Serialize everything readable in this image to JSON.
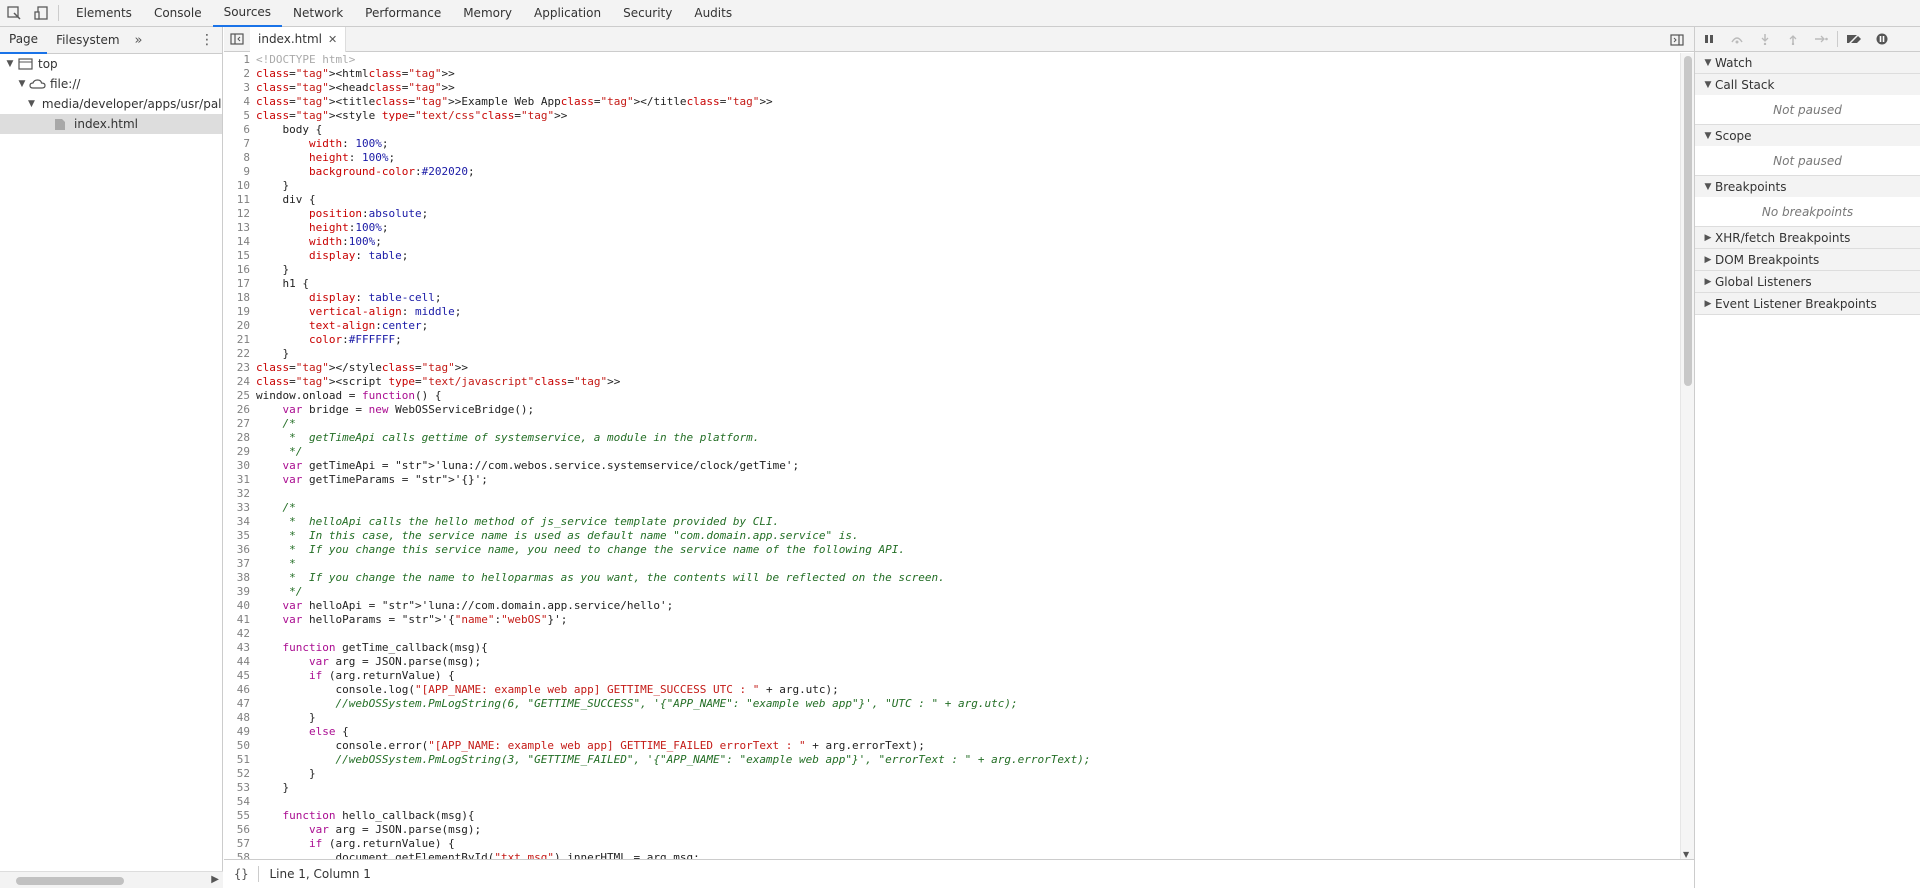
{
  "main_tabs": [
    {
      "label": "Elements"
    },
    {
      "label": "Console"
    },
    {
      "label": "Sources"
    },
    {
      "label": "Network"
    },
    {
      "label": "Performance"
    },
    {
      "label": "Memory"
    },
    {
      "label": "Application"
    },
    {
      "label": "Security"
    },
    {
      "label": "Audits"
    }
  ],
  "navigator": {
    "tabs": [
      {
        "label": "Page"
      },
      {
        "label": "Filesystem"
      }
    ],
    "tree": [
      {
        "label": "top"
      },
      {
        "label": "file://"
      },
      {
        "label": "media/developer/apps/usr/palm/applications/com.domain.app"
      },
      {
        "label": "index.html"
      }
    ]
  },
  "editor": {
    "tab_label": "index.html",
    "lines": [
      "<!DOCTYPE html>",
      "<html>",
      "<head>",
      "<title>Example Web App</title>",
      "<style type=\"text/css\">",
      "    body {",
      "        width: 100%;",
      "        height: 100%;",
      "        background-color:#202020;",
      "    }",
      "    div {",
      "        position:absolute;",
      "        height:100%;",
      "        width:100%;",
      "        display: table;",
      "    }",
      "    h1 {",
      "        display: table-cell;",
      "        vertical-align: middle;",
      "        text-align:center;",
      "        color:#FFFFFF;",
      "    }",
      "</style>",
      "<script type=\"text/javascript\">",
      "window.onload = function() {",
      "    var bridge = new WebOSServiceBridge();",
      "    /*",
      "     *  getTimeApi calls gettime of systemservice, a module in the platform.",
      "     */",
      "    var getTimeApi = 'luna://com.webos.service.systemservice/clock/getTime';",
      "    var getTimeParams = '{}';",
      "",
      "    /*",
      "     *  helloApi calls the hello method of js_service template provided by CLI.",
      "     *  In this case, the service name is used as default name \"com.domain.app.service\" is.",
      "     *  If you change this service name, you need to change the service name of the following API.",
      "     *",
      "     *  If you change the name to helloparmas as you want, the contents will be reflected on the screen.",
      "     */",
      "    var helloApi = 'luna://com.domain.app.service/hello';",
      "    var helloParams = '{\"name\":\"webOS\"}';",
      "",
      "    function getTime_callback(msg){",
      "        var arg = JSON.parse(msg);",
      "        if (arg.returnValue) {",
      "            console.log(\"[APP_NAME: example web app] GETTIME_SUCCESS UTC : \" + arg.utc);",
      "            //webOSSystem.PmLogString(6, \"GETTIME_SUCCESS\", '{\"APP_NAME\": \"example web app\"}', \"UTC : \" + arg.utc);",
      "        }",
      "        else {",
      "            console.error(\"[APP_NAME: example web app] GETTIME_FAILED errorText : \" + arg.errorText);",
      "            //webOSSystem.PmLogString(3, \"GETTIME_FAILED\", '{\"APP_NAME\": \"example web app\"}', \"errorText : \" + arg.errorText);",
      "        }",
      "    }",
      "",
      "    function hello_callback(msg){",
      "        var arg = JSON.parse(msg);",
      "        if (arg.returnValue) {",
      "            document.getElementById(\"txt_msg\").innerHTML = arg.msg;"
    ]
  },
  "status": {
    "braces": "{}",
    "position": "Line 1, Column 1"
  },
  "debugger": {
    "sections": [
      {
        "label": "Watch",
        "expanded": true,
        "body": ""
      },
      {
        "label": "Call Stack",
        "expanded": true,
        "body": "Not paused"
      },
      {
        "label": "Scope",
        "expanded": true,
        "body": "Not paused"
      },
      {
        "label": "Breakpoints",
        "expanded": true,
        "body": "No breakpoints"
      },
      {
        "label": "XHR/fetch Breakpoints",
        "expanded": false,
        "body": ""
      },
      {
        "label": "DOM Breakpoints",
        "expanded": false,
        "body": ""
      },
      {
        "label": "Global Listeners",
        "expanded": false,
        "body": ""
      },
      {
        "label": "Event Listener Breakpoints",
        "expanded": false,
        "body": ""
      }
    ]
  }
}
